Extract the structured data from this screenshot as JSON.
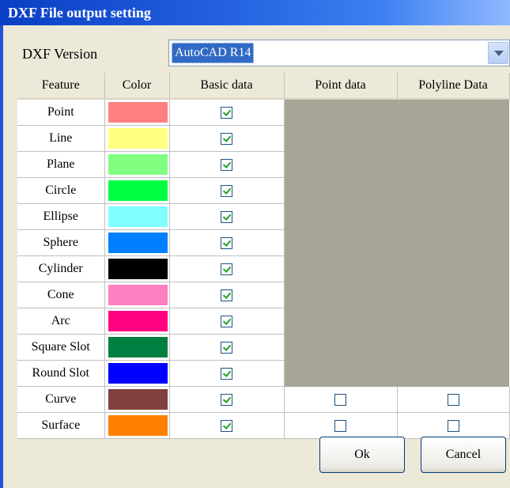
{
  "window": {
    "title": "DXF File output setting"
  },
  "version": {
    "label": "DXF Version",
    "value": "AutoCAD R14"
  },
  "columns": [
    "Feature",
    "Color",
    "Basic data",
    "Point data",
    "Polyline Data"
  ],
  "rows": [
    {
      "feature": "Point",
      "color": "#ff8080",
      "basic": true
    },
    {
      "feature": "Line",
      "color": "#ffff80",
      "basic": true
    },
    {
      "feature": "Plane",
      "color": "#80ff80",
      "basic": true
    },
    {
      "feature": "Circle",
      "color": "#00ff40",
      "basic": true
    },
    {
      "feature": "Ellipse",
      "color": "#80ffff",
      "basic": true
    },
    {
      "feature": "Sphere",
      "color": "#0080ff",
      "basic": true
    },
    {
      "feature": "Cylinder",
      "color": "#000000",
      "basic": true
    },
    {
      "feature": "Cone",
      "color": "#ff80c0",
      "basic": true
    },
    {
      "feature": "Arc",
      "color": "#ff0080",
      "basic": true
    },
    {
      "feature": "Square Slot",
      "color": "#008040",
      "basic": true
    },
    {
      "feature": "Round Slot",
      "color": "#0000ff",
      "basic": true
    },
    {
      "feature": "Curve",
      "color": "#804040",
      "basic": true,
      "point": false,
      "polyline": false
    },
    {
      "feature": "Surface",
      "color": "#ff8000",
      "basic": true,
      "point": false,
      "polyline": false
    }
  ],
  "buttons": {
    "ok": "Ok",
    "cancel": "Cancel"
  }
}
